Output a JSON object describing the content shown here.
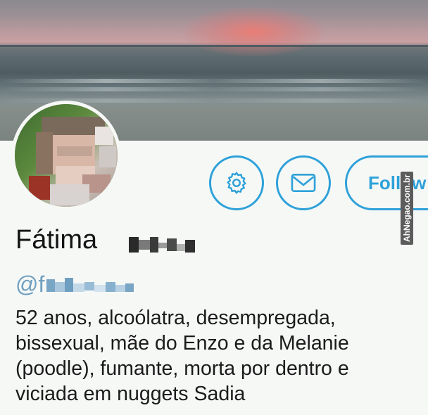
{
  "profile": {
    "name": "Fátima",
    "handle_prefix": "@f",
    "bio_lines": [
      "52 anos, alcoólatra, desempregada,",
      "bissexual, mãe do Enzo e da Melanie",
      "(poodle), fumante, morta por dentro e",
      "viciada em nuggets Sadia"
    ]
  },
  "actions": {
    "settings_icon": "gear-icon",
    "message_icon": "envelope-icon",
    "follow_label": "Follow"
  },
  "watermark": "AhNegao.com.br",
  "colors": {
    "accent": "#2ea1d9",
    "handle": "#6f9fc0",
    "text": "#1b1b1b"
  }
}
